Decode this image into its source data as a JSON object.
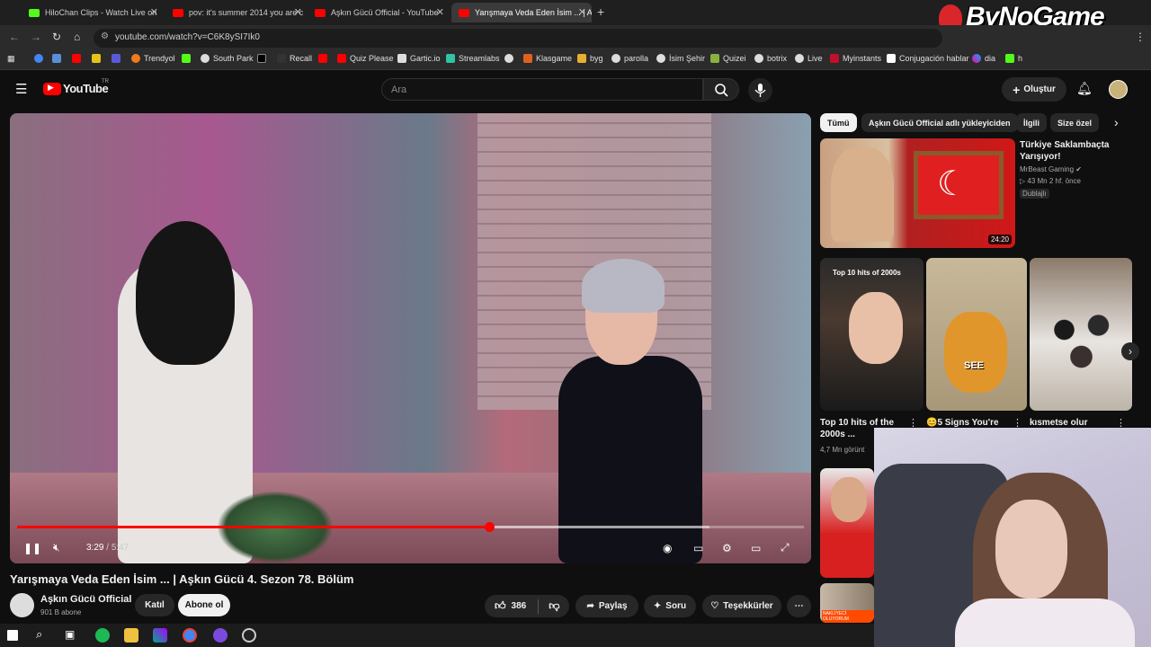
{
  "browser": {
    "tabs": [
      {
        "label": "HiloChan Clips - Watch Live on",
        "color": "#53fc18"
      },
      {
        "label": "pov: it's summer 2014 you are c",
        "color": "#ff0000"
      },
      {
        "label": "Aşkın Gücü Official - YouTube",
        "color": "#ff0000"
      },
      {
        "label": "Yarışmaya Veda Eden İsim ... | A",
        "color": "#ff0000"
      }
    ],
    "url": "youtube.com/watch?v=C6K8ySI7Ik0",
    "bookmarks": [
      "Trendyol",
      "South Park",
      "Recall",
      "Quiz Please",
      "Gartic.io",
      "Streamlabs",
      "Klasgame",
      "byg",
      "parolla",
      "İsim Şehir",
      "Quizei",
      "botrix",
      "Live",
      "Myinstants",
      "Conjugación hablar",
      "dia",
      "h"
    ]
  },
  "youtube": {
    "logo": "YouTube",
    "region": "TR",
    "search_placeholder": "Ara",
    "create_label": "Oluştur"
  },
  "player": {
    "time_current": "3:29",
    "time_total": "5:47",
    "progress": 0.6,
    "buffered": 0.88
  },
  "video": {
    "title": "Yarışmaya Veda Eden İsim ... | Aşkın Gücü 4. Sezon 78. Bölüm",
    "channel": "Aşkın Gücü Official",
    "subscribers": "901 B abone",
    "join_label": "Katıl",
    "subscribe_label": "Abone ol",
    "likes": "386",
    "share_label": "Paylaş",
    "ask_label": "Soru",
    "thanks_label": "Teşekkürler"
  },
  "sidebar": {
    "chips": [
      "Tümü",
      "Aşkın Gücü Official adlı yükleyiciden",
      "İlgili",
      "Size özel"
    ],
    "first": {
      "title": "Türkiye Saklambaçta Yarışıyor!",
      "channel": "MrBeast Gaming",
      "stats": "43 Mn  2 hf. önce",
      "badge": "Dublajlı",
      "duration": "24:20"
    },
    "shorts": [
      {
        "title": "Top 10 hits of the 2000s ...",
        "meta": "4,7 Mn görünt",
        "overlay": "Top 10 hits of 2000s"
      },
      {
        "title": "5 Signs You're",
        "meta": "",
        "overlay": "SEE"
      },
      {
        "title": "kısmetse olur",
        "meta": "",
        "overlay": ""
      }
    ],
    "next_item_badge": "NAKLİYECİ OLUYORUM"
  },
  "watermark": {
    "text": "ByNoGame"
  }
}
